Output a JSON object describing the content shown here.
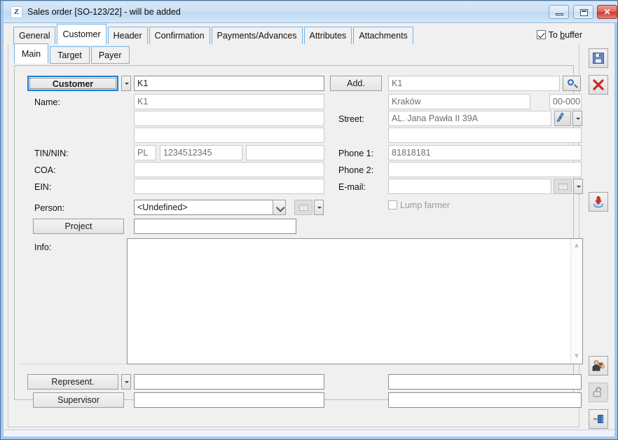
{
  "window": {
    "icon_letter": "Z",
    "title": "Sales order [SO-123/22] - will be added",
    "minimize_label": "",
    "restore_label": "",
    "close_label": "✕"
  },
  "tabs": [
    {
      "label": "General",
      "active": false
    },
    {
      "label": "Customer",
      "active": true
    },
    {
      "label": "Header",
      "active": false
    },
    {
      "label": "Confirmation",
      "active": false
    },
    {
      "label": "Payments/Advances",
      "active": false
    },
    {
      "label": "Attributes",
      "active": false
    },
    {
      "label": "Attachments",
      "active": false
    }
  ],
  "to_buffer": {
    "label_prefix": "To ",
    "label_accel": "b",
    "label_suffix": "uffer",
    "checked": true
  },
  "subtabs": [
    {
      "label": "Main",
      "active": true
    },
    {
      "label": "Target",
      "active": false
    },
    {
      "label": "Payer",
      "active": false
    }
  ],
  "form": {
    "customer_button": "Customer",
    "customer_code": "K1",
    "name_label": "Name:",
    "name_line1": "K1",
    "name_line2": "",
    "name_line3": "",
    "tin_label": "TIN/NIN:",
    "tin_prefix": "PL",
    "tin_number": "1234512345",
    "tin_extra": "",
    "coa_label": "COA:",
    "coa_value": "",
    "ein_label": "EIN:",
    "ein_value": "",
    "person_label": "Person:",
    "person_value": "<Undefined>",
    "project_button": "Project",
    "project_value": "",
    "info_label": "Info:",
    "info_value": "",
    "add_button": "Add.",
    "add_code": "K1",
    "city": "Kraków",
    "postcode": "00-000",
    "street_label": "Street:",
    "street_value": "AL. Jana Pawła II 39A",
    "street_line2": "",
    "phone1_label": "Phone 1:",
    "phone1_value": "81818181",
    "phone2_label": "Phone 2:",
    "phone2_value": "",
    "email_label": "E-mail:",
    "email_value": "",
    "lump_farmer_label": "Lump farmer",
    "lump_farmer_checked": false,
    "represent_button": "Represent.",
    "represent_value": "",
    "represent_value2": "",
    "supervisor_button": "Supervisor",
    "supervisor_value": "",
    "supervisor_value2": ""
  },
  "toolbar": {
    "save": "save-icon",
    "cancel": "cancel-icon",
    "import": "import-icon",
    "person_key": "person-rights-icon",
    "unlock": "unlock-icon",
    "pin": "pin-icon"
  },
  "colors": {
    "accent": "#1c7fd6",
    "tab_border": "#71b5e8",
    "close": "#c9392e",
    "titlebar": "#cfe2f5"
  }
}
